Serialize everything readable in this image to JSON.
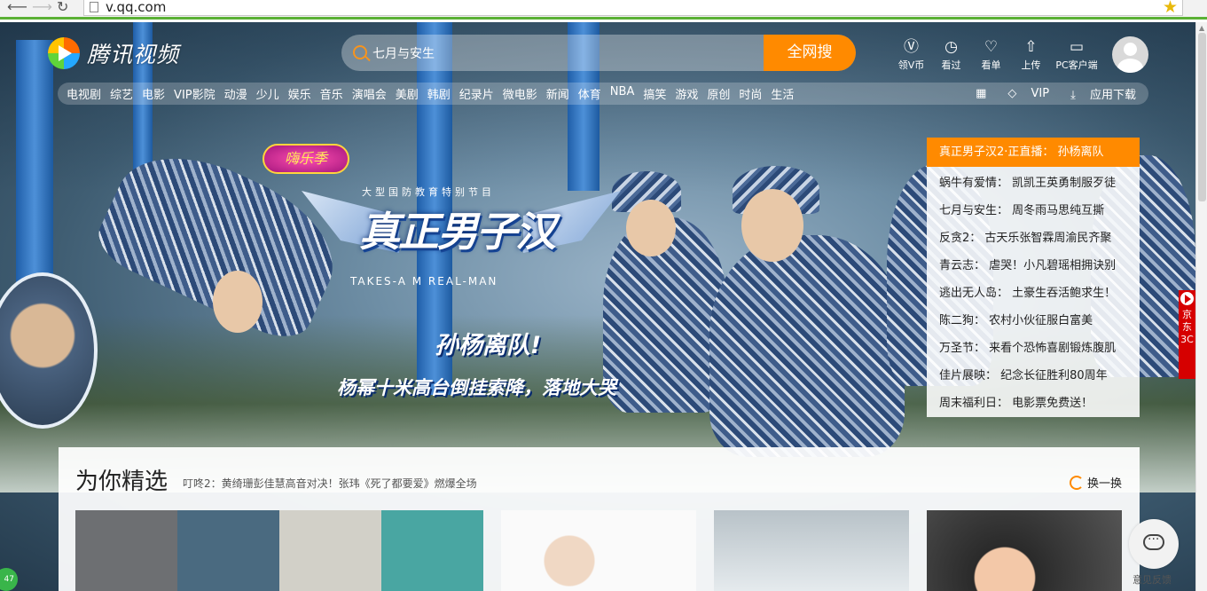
{
  "browser": {
    "url": "v.qq.com"
  },
  "header": {
    "logo": "腾讯视频",
    "search": {
      "value": "七月与安生",
      "button": "全网搜"
    },
    "tools": [
      {
        "icon": "v-coin-icon",
        "glyph": "Ⓥ",
        "label": "领V币"
      },
      {
        "icon": "history-icon",
        "glyph": "◷",
        "label": "看过"
      },
      {
        "icon": "watchlist-icon",
        "glyph": "♡",
        "label": "看单"
      },
      {
        "icon": "upload-icon",
        "glyph": "⇧",
        "label": "上传"
      },
      {
        "icon": "pc-client-icon",
        "glyph": "▭",
        "label": "PC客户端"
      }
    ]
  },
  "nav": {
    "categories": [
      "电视剧",
      "综艺",
      "电影",
      "VIP影院",
      "动漫",
      "少儿",
      "娱乐",
      "音乐",
      "演唱会",
      "美剧",
      "韩剧",
      "纪录片",
      "微电影",
      "新闻",
      "体育",
      "NBA",
      "搞笑",
      "游戏",
      "原创",
      "时尚",
      "生活"
    ],
    "vip": "VIP",
    "download": "应用下载"
  },
  "promo": {
    "badge": "嗨乐季",
    "subtitle": "大型国防教育特别节目",
    "title": "真正男子汉",
    "en": "TAKES-A  M  REAL-MAN",
    "slogan": "孙杨离队!",
    "caption": "杨幂十米高台倒挂索降，落地大哭",
    "jd": "京东3C"
  },
  "news": {
    "head": "真正男子汉2·正直播： 孙杨离队",
    "items": [
      "蜗牛有爱情： 凯凯王英勇制服歹徒",
      "七月与安生： 周冬雨马思纯互撕",
      "反贪2： 古天乐张智霖周渝民齐聚",
      "青云志： 虐哭！小凡碧瑶相拥诀别",
      "逃出无人岛： 土豪生吞活鲍求生！",
      "陈二狗： 农村小伙征服白富美",
      "万圣节： 来看个恐怖喜剧锻炼腹肌",
      "佳片展映： 纪念长征胜利80周年",
      "周末福利日： 电影票免费送！"
    ]
  },
  "picks": {
    "title": "为你精选",
    "subtitle": "叮咚2：黄绮珊彭佳慧高音对决！张玮《死了都要爱》燃爆全场",
    "refresh": "换一换"
  },
  "feedback": "意见反馈",
  "side_badge": "47"
}
